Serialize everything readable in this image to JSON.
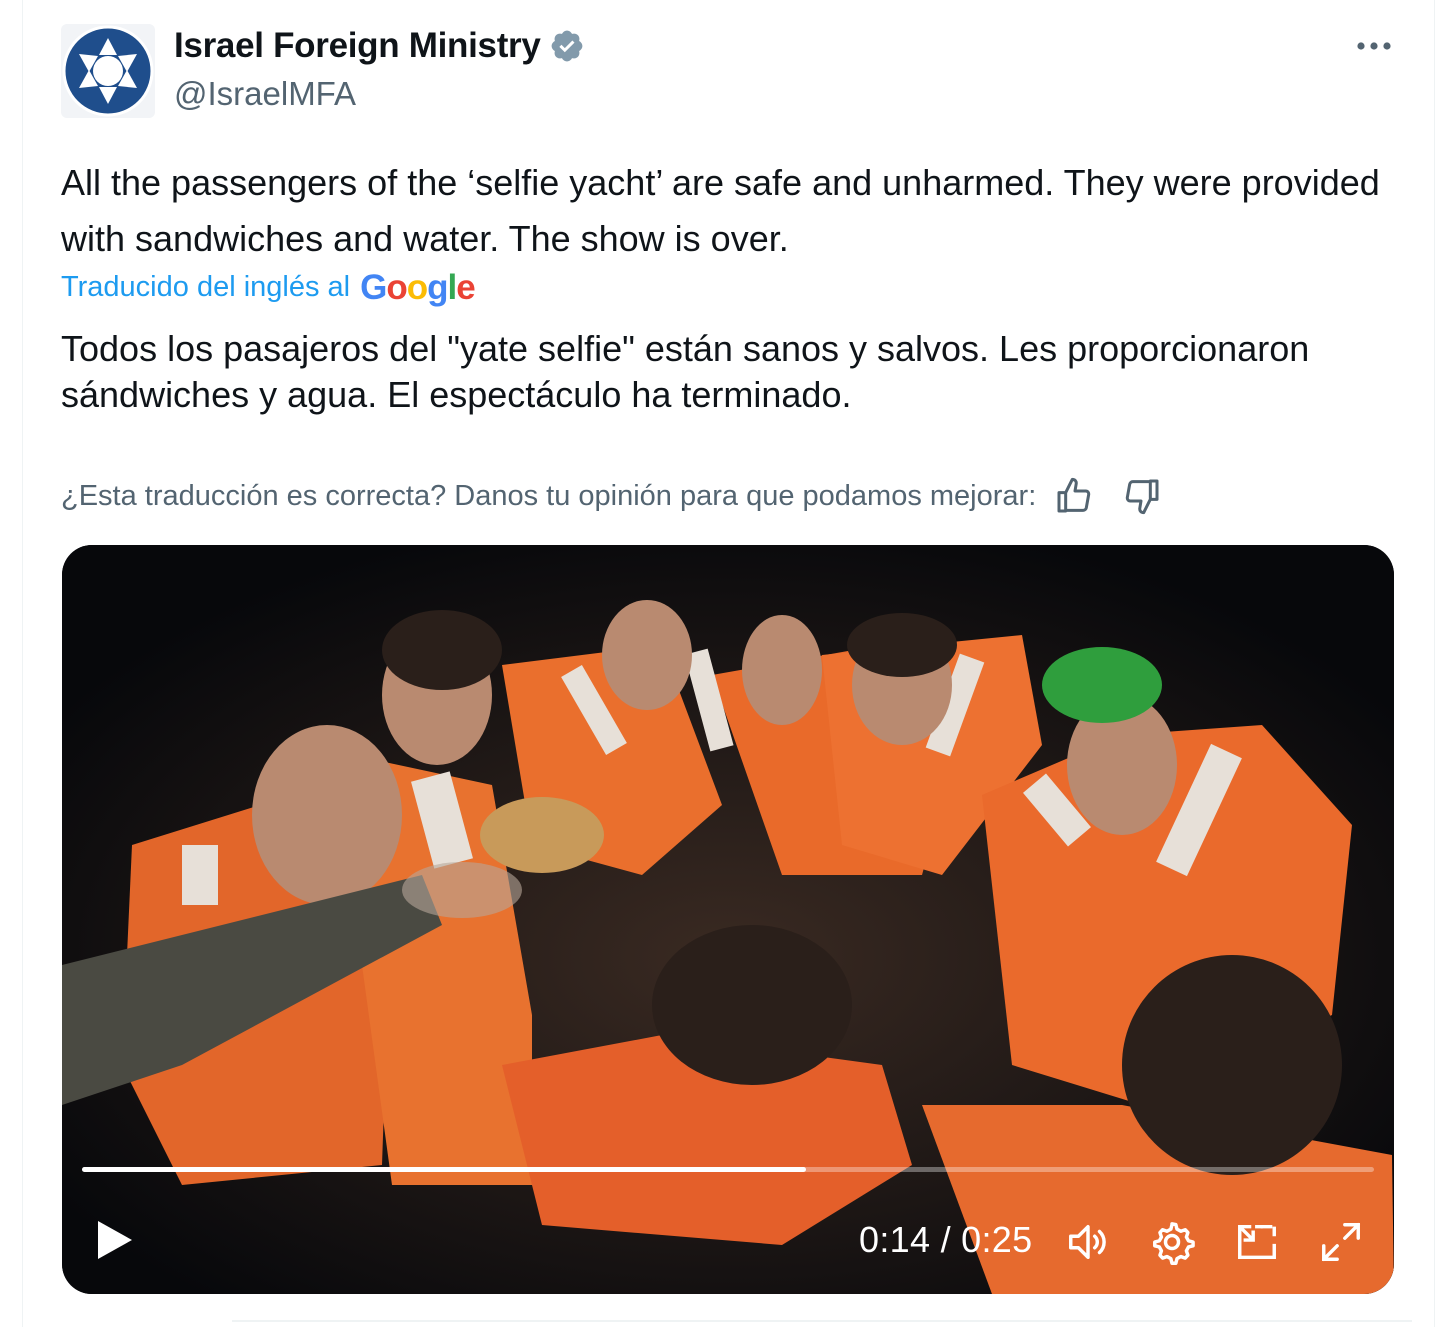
{
  "tweet": {
    "author_name": "Israel Foreign Ministry",
    "author_handle": "@IsraelMFA",
    "text": "All the passengers of the ‘selfie yacht’ are safe and unharmed. They were provided with sandwiches and water. The show is over.",
    "translation_label": "Traducido del inglés al",
    "translation_provider": "Google",
    "translated_text": "Todos los pasajeros del \"yate selfie\" están sanos y salvos. Les proporcionaron sándwiches y agua. El espectáculo ha terminado.",
    "feedback_prompt": "¿Esta traducción es correcta? Danos tu opinión para que podamos mejorar:"
  },
  "video": {
    "current_time": "0:14",
    "duration": "0:25",
    "time_display": "0:14 / 0:25",
    "progress_fraction": 0.56
  },
  "icons": {
    "verified": "verified-badge-icon",
    "more": "more-options-icon",
    "thumbs_up": "thumbs-up-icon",
    "thumbs_down": "thumbs-down-icon",
    "play": "play-icon",
    "volume": "volume-icon",
    "settings": "gear-icon",
    "pip": "picture-in-picture-icon",
    "fullscreen": "fullscreen-icon"
  },
  "colors": {
    "link_blue": "#1d9bf0",
    "secondary_text": "#536471",
    "verified_badge": "#829aab",
    "logo_blue": "#1f4e8c"
  }
}
